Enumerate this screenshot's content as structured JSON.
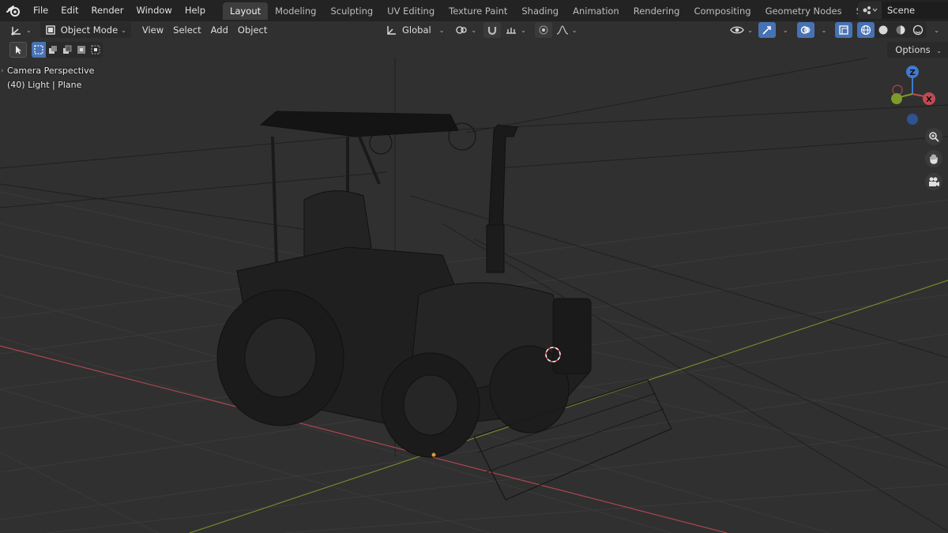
{
  "topbar": {
    "menus": [
      "File",
      "Edit",
      "Render",
      "Window",
      "Help"
    ],
    "workspaces": [
      "Layout",
      "Modeling",
      "Sculpting",
      "UV Editing",
      "Texture Paint",
      "Shading",
      "Animation",
      "Rendering",
      "Compositing",
      "Geometry Nodes",
      "Scripting"
    ],
    "active_workspace": "Layout",
    "add_label": "+",
    "scene_name": "Scene"
  },
  "header": {
    "mode": "Object Mode",
    "menus": [
      "View",
      "Select",
      "Add",
      "Object"
    ],
    "orientation": "Global"
  },
  "toolrow": {
    "options_label": "Options"
  },
  "viewport": {
    "view_name": "Camera Perspective",
    "object_info": "(40) Light | Plane"
  },
  "gizmo": {
    "z_label": "Z",
    "x_label": "X"
  },
  "colors": {
    "accent": "#4772b3",
    "x_axis": "#c24a55",
    "y_axis": "#7d9a2a",
    "z_axis": "#3e7ad1"
  }
}
